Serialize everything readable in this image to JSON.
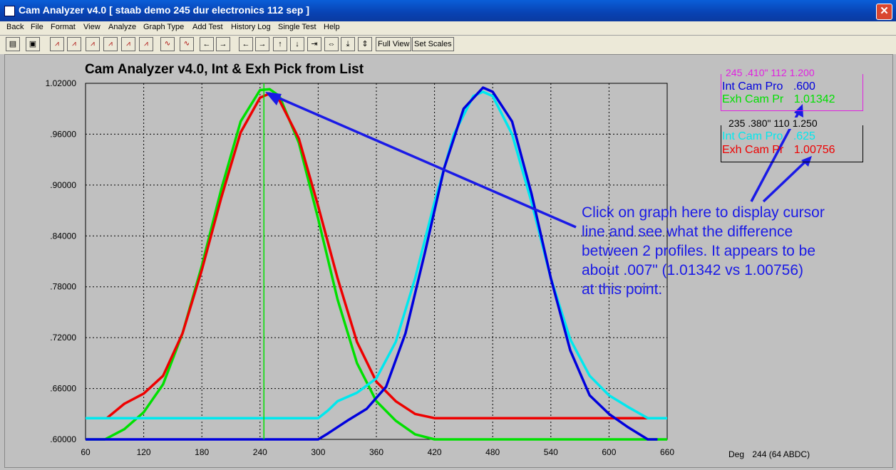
{
  "window": {
    "title": "Cam Analyzer v4.0  [ staab demo 245 dur electronics 112 sep ]",
    "close_glyph": "✕"
  },
  "menu": [
    "Back",
    "File",
    "Format",
    "View",
    "Analyze",
    "Graph Type",
    "Add Test",
    "History Log",
    "Single Test",
    "Help"
  ],
  "toolbar": {
    "full_view_label": "Full View",
    "set_scales_label": "Set Scales"
  },
  "legend1": {
    "title": "245 .410\" 112 1.200",
    "int_label": "Int Cam Pro",
    "int_value": ".600",
    "exh_label": "Exh Cam Pr",
    "exh_value": "1.01342",
    "title_color": "#e020e0",
    "int_color": "#0000dd",
    "exh_color": "#00e000"
  },
  "legend2": {
    "title": "235 .380\" 110 1.250",
    "int_label": "Int Cam Pro",
    "int_value": ".625",
    "exh_label": "Exh Cam Pr",
    "exh_value": "1.00756",
    "title_color": "#000000",
    "int_color": "#00e8ee",
    "exh_color": "#ee0000"
  },
  "annotation": {
    "lines": [
      "Click on graph here to display cursor",
      "line and see what the difference",
      "between 2 profiles.  It appears to be",
      "about .007\" (1.01342  vs 1.00756)",
      "at this point."
    ],
    "color": "#1a1ae6"
  },
  "readout": {
    "label": "Deg",
    "value": "244  (64 ABDC)"
  },
  "chart_data": {
    "type": "line",
    "title": "Cam Analyzer v4.0,   Int & Exh Pick from List",
    "xlim": [
      60,
      660
    ],
    "ylim": [
      0.6,
      1.02
    ],
    "x_ticks": [
      "60",
      "120",
      "180",
      "240",
      "300",
      "360",
      "420",
      "480",
      "540",
      "600",
      "660"
    ],
    "y_ticks": [
      ".60000",
      ".66000",
      ".72000",
      ".78000",
      ".84000",
      ".90000",
      ".96000",
      "1.02000"
    ],
    "grid": true,
    "cursor_x": 244,
    "series": [
      {
        "name": "Exh Cam Pr",
        "color": "#00e000",
        "x": [
          60,
          80,
          100,
          120,
          140,
          160,
          180,
          200,
          220,
          240,
          250,
          260,
          280,
          300,
          320,
          340,
          360,
          380,
          400,
          420,
          440,
          480,
          560,
          660
        ],
        "y": [
          0.6,
          0.6,
          0.612,
          0.632,
          0.665,
          0.725,
          0.805,
          0.895,
          0.975,
          1.012,
          1.013,
          1.005,
          0.95,
          0.86,
          0.765,
          0.69,
          0.645,
          0.622,
          0.606,
          0.6,
          0.6,
          0.6,
          0.6,
          0.6
        ]
      },
      {
        "name": "Exh Cam Pr",
        "color": "#ee0000",
        "x": [
          60,
          82,
          100,
          120,
          140,
          160,
          180,
          200,
          220,
          240,
          250,
          260,
          280,
          300,
          320,
          340,
          360,
          380,
          400,
          420,
          450,
          550,
          645
        ],
        "y": [
          0.625,
          0.625,
          0.642,
          0.654,
          0.675,
          0.725,
          0.8,
          0.885,
          0.962,
          1.003,
          1.008,
          1.0,
          0.955,
          0.875,
          0.79,
          0.715,
          0.668,
          0.645,
          0.63,
          0.625,
          0.625,
          0.625,
          0.625
        ]
      },
      {
        "name": "Int Cam Pro",
        "color": "#00e8ee",
        "x": [
          60,
          100,
          200,
          300,
          310,
          320,
          340,
          360,
          380,
          400,
          420,
          440,
          460,
          470,
          480,
          500,
          520,
          540,
          560,
          580,
          600,
          620,
          640,
          660
        ],
        "y": [
          0.625,
          0.625,
          0.625,
          0.625,
          0.634,
          0.645,
          0.655,
          0.672,
          0.715,
          0.79,
          0.88,
          0.96,
          1.005,
          1.01,
          1.005,
          0.96,
          0.88,
          0.79,
          0.718,
          0.675,
          0.652,
          0.638,
          0.625,
          0.625
        ]
      },
      {
        "name": "Int Cam Pro",
        "color": "#0000dd",
        "x": [
          60,
          200,
          300,
          310,
          330,
          350,
          370,
          390,
          410,
          430,
          450,
          470,
          480,
          500,
          520,
          540,
          560,
          580,
          600,
          620,
          640,
          650
        ],
        "y": [
          0.6,
          0.6,
          0.6,
          0.607,
          0.622,
          0.636,
          0.662,
          0.725,
          0.82,
          0.92,
          0.99,
          1.015,
          1.01,
          0.975,
          0.89,
          0.79,
          0.705,
          0.652,
          0.63,
          0.614,
          0.6,
          0.6
        ]
      }
    ]
  }
}
